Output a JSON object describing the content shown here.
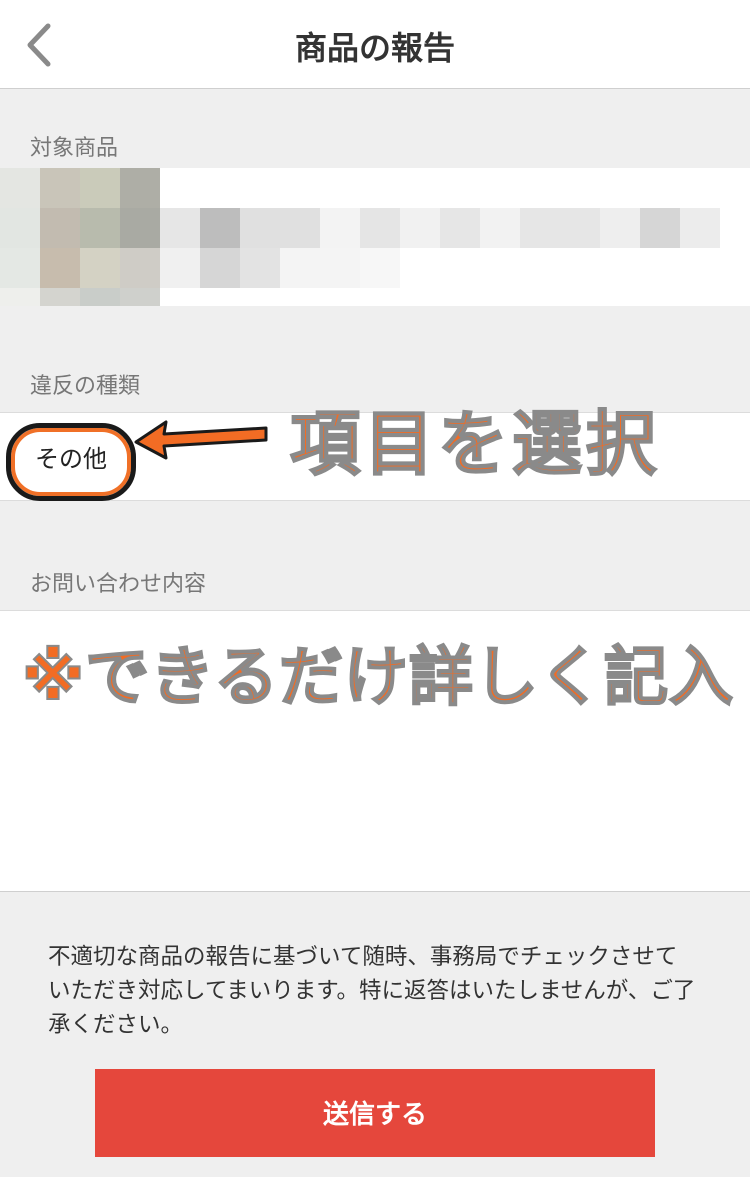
{
  "header": {
    "title": "商品の報告",
    "back_icon": "chevron-left-icon"
  },
  "product_section": {
    "label": "対象商品"
  },
  "violation_section": {
    "label": "違反の種類",
    "selected": "その他"
  },
  "inquiry_section": {
    "label": "お問い合わせ内容",
    "value": ""
  },
  "annotations": {
    "select_item": "項目を選択",
    "write_detail": "※できるだけ詳しく記入",
    "color": "#f26c24"
  },
  "notice": "不適切な商品の報告に基づいて随時、事務局でチェックさせていただき対応してまいります。特に返答はいたしませんが、ご了承ください。",
  "submit_button": {
    "label": "送信する",
    "color": "#e5473c"
  }
}
